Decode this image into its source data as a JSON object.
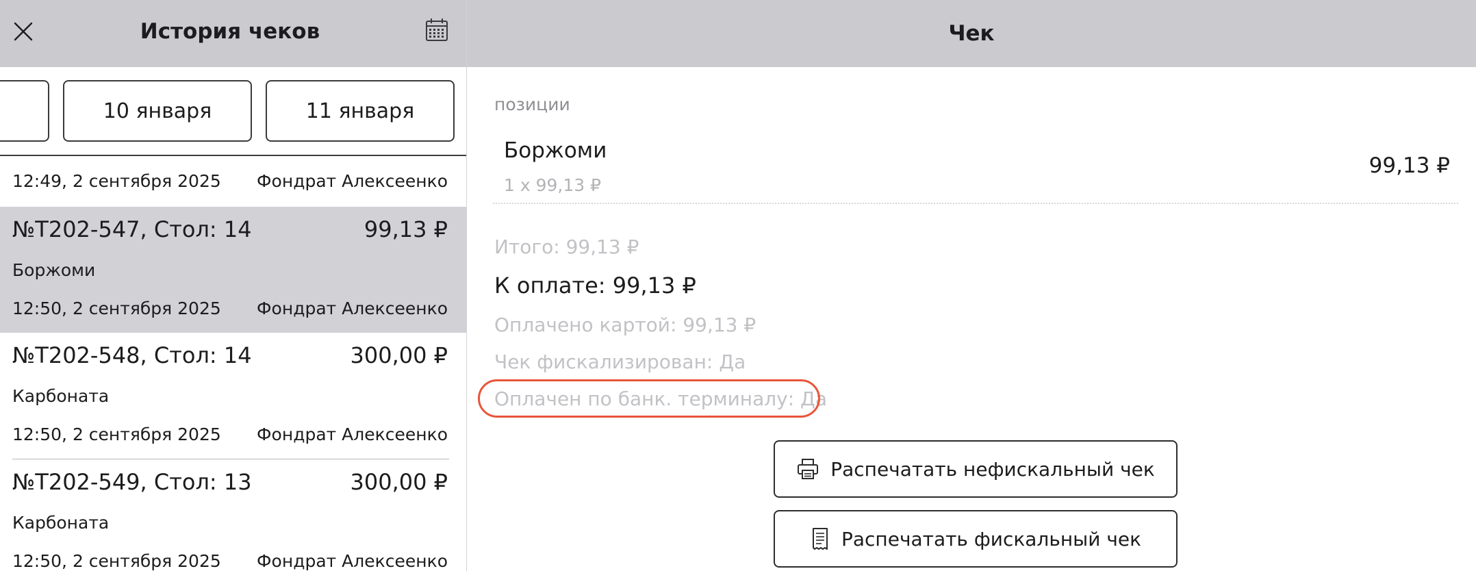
{
  "left_panel": {
    "title": "История чеков",
    "date_tabs": [
      {
        "label": ""
      },
      {
        "label": "10 января"
      },
      {
        "label": "11 января"
      }
    ],
    "top_row": {
      "time": "12:49, 2 сентября 2025",
      "author": "Фондрат Алексеенко"
    },
    "receipts": [
      {
        "title": "№Т202-547, Стол: 14",
        "amount": "99,13 ₽",
        "item": "Боржоми",
        "time": "12:50, 2 сентября 2025",
        "author": "Фондрат Алексеенко",
        "selected": true
      },
      {
        "title": "№Т202-548, Стол: 14",
        "amount": "300,00 ₽",
        "item": "Карбоната",
        "time": "12:50, 2 сентября 2025",
        "author": "Фондрат Алексеенко",
        "selected": false
      },
      {
        "title": "№Т202-549, Стол: 13",
        "amount": "300,00 ₽",
        "item": "Карбоната",
        "time": "12:50, 2 сентября 2025",
        "author": "Фондрат Алексеенко",
        "selected": false
      }
    ]
  },
  "right_panel": {
    "title": "Чек",
    "section_label": "позиции",
    "position": {
      "name": "Боржоми",
      "qty": "1 x 99,13 ₽",
      "amount": "99,13 ₽"
    },
    "summary": {
      "total": "Итого: 99,13 ₽",
      "to_pay": "К оплате: 99,13 ₽",
      "paid_card": "Оплачено картой: 99,13 ₽",
      "fiscalized": "Чек фискализирован: Да",
      "bank_terminal": "Оплачен по банк. терминалу: Да"
    },
    "buttons": {
      "print_nonfiscal": "Распечатать нефискальный чек",
      "print_fiscal": "Распечатать фискальный чек"
    }
  },
  "icons": {
    "close": "close-icon",
    "calendar": "calendar-icon",
    "printer": "printer-icon",
    "receipt": "receipt-icon"
  },
  "colors": {
    "header_bg": "#cbcbcf",
    "selected_row": "#d1d1d6",
    "highlight_ring": "#e8553a",
    "muted_text": "#c2c2c6"
  }
}
